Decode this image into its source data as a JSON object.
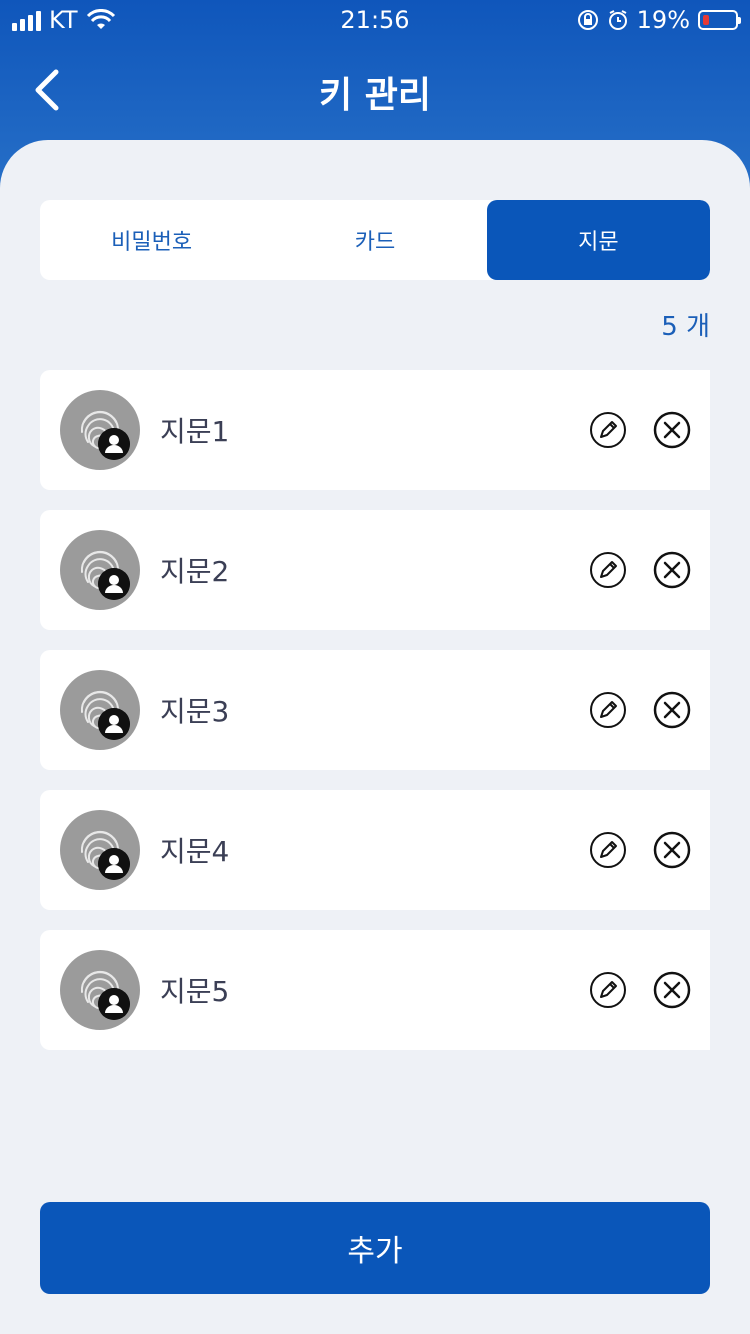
{
  "status": {
    "carrier": "KT",
    "time": "21:56",
    "battery": "19%"
  },
  "header": {
    "title": "키 관리"
  },
  "tabs": [
    {
      "label": "비밀번호"
    },
    {
      "label": "카드"
    },
    {
      "label": "지문"
    }
  ],
  "active_tab": "지문",
  "count": "5 개",
  "items": [
    {
      "label": "지문1"
    },
    {
      "label": "지문2"
    },
    {
      "label": "지문3"
    },
    {
      "label": "지문4"
    },
    {
      "label": "지문5"
    }
  ],
  "add_button": {
    "label": "추가"
  },
  "colors": {
    "primary": "#0a56b9",
    "background": "#eef1f6",
    "battery_low": "#e53935"
  },
  "icons": [
    "signal-icon",
    "wifi-icon",
    "rotation-lock-icon",
    "alarm-icon",
    "battery-icon",
    "back-chevron-icon",
    "fingerprint-icon",
    "user-badge-icon",
    "pencil-icon",
    "close-circle-icon"
  ]
}
